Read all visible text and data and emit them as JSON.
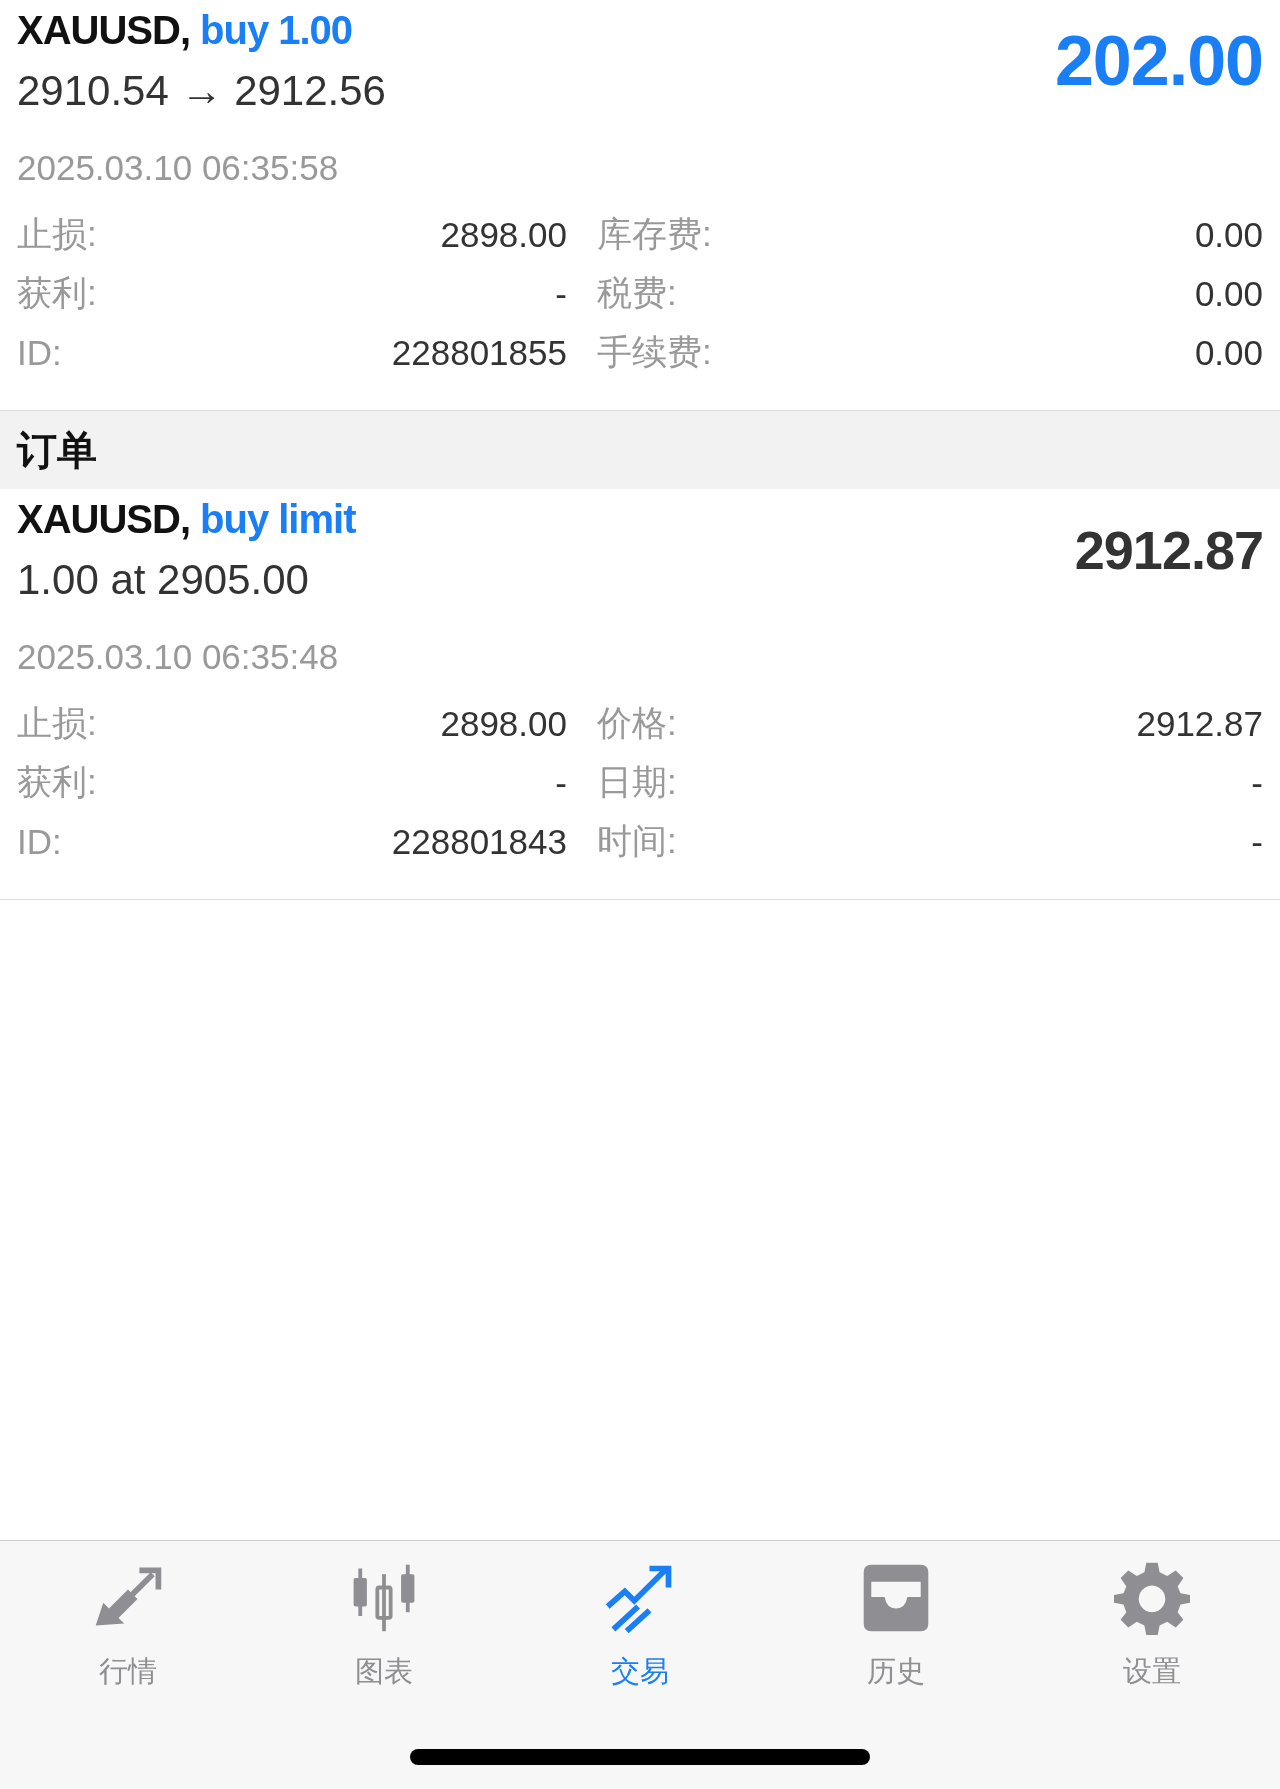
{
  "positions": [
    {
      "kind": "position",
      "symbol": "XAUUSD,",
      "action": "buy 1.00",
      "prices": "2910.54 → 2912.56",
      "value": "202.00",
      "time": "2025.03.10 06:35:58",
      "details": [
        {
          "left_label": "止损:",
          "left_value": "2898.00",
          "right_label": "库存费:",
          "right_value": "0.00"
        },
        {
          "left_label": "获利:",
          "left_value": "-",
          "right_label": "税费:",
          "right_value": "0.00"
        },
        {
          "left_label": "ID:",
          "left_value": "228801855",
          "right_label": "手续费:",
          "right_value": "0.00"
        }
      ]
    }
  ],
  "orders_header": "订单",
  "orders": [
    {
      "kind": "order",
      "symbol": "XAUUSD,",
      "action": "buy limit",
      "prices": "1.00 at 2905.00",
      "value": "2912.87",
      "time": "2025.03.10 06:35:48",
      "details": [
        {
          "left_label": "止损:",
          "left_value": "2898.00",
          "right_label": "价格:",
          "right_value": "2912.87"
        },
        {
          "left_label": "获利:",
          "left_value": "-",
          "right_label": "日期:",
          "right_value": "-"
        },
        {
          "left_label": "ID:",
          "left_value": "228801843",
          "right_label": "时间:",
          "right_value": "-"
        }
      ]
    }
  ],
  "tab_bar": {
    "tabs": [
      {
        "kind": "quotes",
        "label": "行情",
        "selected": false
      },
      {
        "kind": "chart",
        "label": "图表",
        "selected": false
      },
      {
        "kind": "trade",
        "label": "交易",
        "selected": true
      },
      {
        "kind": "history",
        "label": "历史",
        "selected": false
      },
      {
        "kind": "settings",
        "label": "设置",
        "selected": false
      }
    ]
  }
}
